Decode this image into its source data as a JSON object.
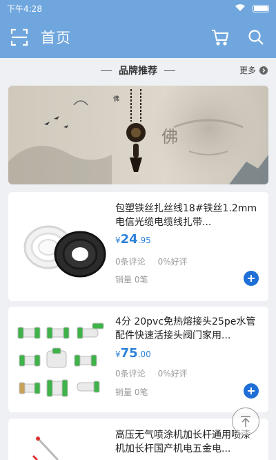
{
  "statusbar": {
    "time": "下午4:28"
  },
  "appbar": {
    "title": "首页"
  },
  "section": {
    "title": "品牌推荐",
    "more": "更多"
  },
  "products": [
    {
      "name": "包塑铁丝扎丝线18#铁丝1.2mm电信光缆电缆线扎带...",
      "currency": "¥",
      "price_int": "24",
      "price_dec": ".95",
      "reviews": "0条评论",
      "rating": "0%好评",
      "sales": "销量 0笔"
    },
    {
      "name": "4分 20pvc免热熔接头25pe水管配件快速活接头阀门家用...",
      "currency": "¥",
      "price_int": "75",
      "price_dec": ".00",
      "reviews": "0条评论",
      "rating": "0%好评",
      "sales": "销量 0笔"
    },
    {
      "name": "高压无气喷涂机加长杆通用喷漆机加长杆国产机电五金电..."
    }
  ],
  "colors": {
    "primary": "#6fa6dd",
    "price": "#2d82d9",
    "add_button": "#1f6fd6"
  }
}
